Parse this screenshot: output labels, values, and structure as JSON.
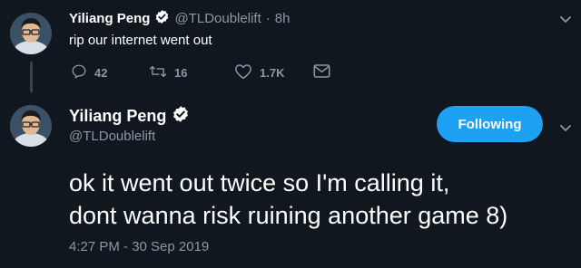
{
  "reply_tweet": {
    "display_name": "Yiliang Peng",
    "handle": "@TLDoublelift",
    "separator": "·",
    "age": "8h",
    "text": "rip our internet went out",
    "actions": {
      "replies": "42",
      "retweets": "16",
      "likes": "1.7K"
    },
    "icons": [
      "reply-icon",
      "retweet-icon",
      "like-icon",
      "message-icon",
      "chevron-down-icon",
      "verified-badge-icon"
    ]
  },
  "main_tweet": {
    "display_name": "Yiliang Peng",
    "handle": "@TLDoublelift",
    "follow_label": "Following",
    "text": "ok it went out twice so I'm calling it,\ndont wanna risk ruining another game 8)",
    "timestamp": "4:27 PM - 30 Sep 2019"
  },
  "colors": {
    "background": "#10171e",
    "accent": "#1da1f2",
    "muted": "#8899a6"
  }
}
